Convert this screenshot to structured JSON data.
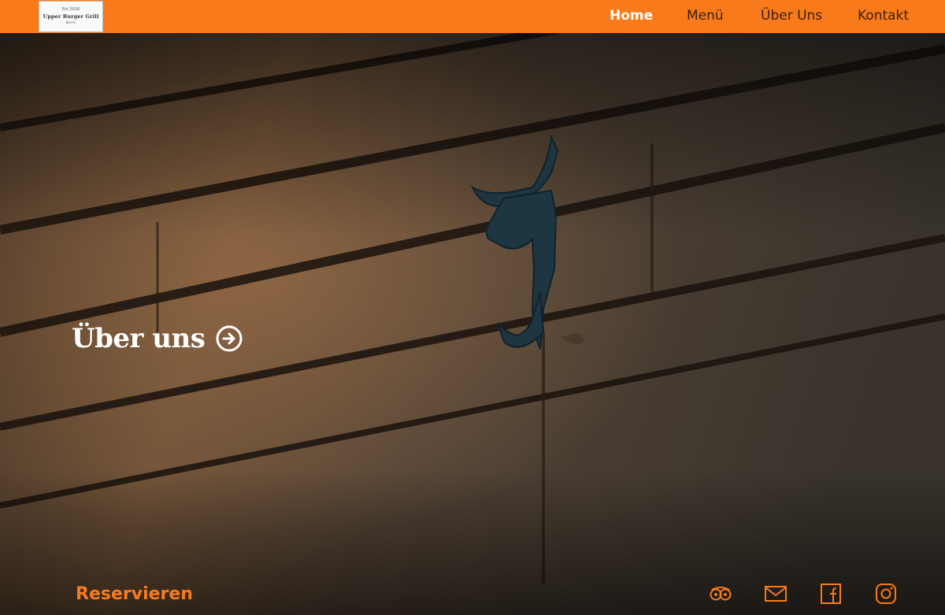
{
  "logo": {
    "small_text": "Est 2016",
    "name": "Upper Burger Grill",
    "city": "Berlin"
  },
  "nav": {
    "items": [
      "Home",
      "Menü",
      "Über Uns",
      "Kontakt"
    ],
    "active": "Home"
  },
  "hero": {
    "heading": "Über uns"
  },
  "footer": {
    "reserve_label": "Reservieren",
    "social_icons": [
      "tripadvisor-icon",
      "mail-icon",
      "facebook-icon",
      "instagram-icon"
    ]
  },
  "colors": {
    "accent": "#f97a1b",
    "nav_text": "#3a200e",
    "hero_text": "#ffffff"
  }
}
